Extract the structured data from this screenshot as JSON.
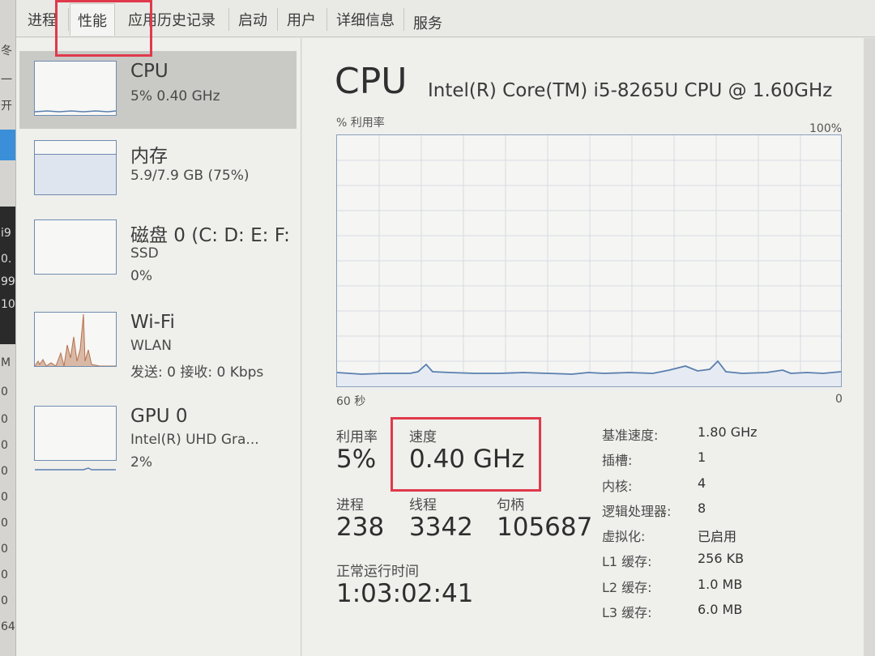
{
  "tabs": [
    {
      "label": "进程"
    },
    {
      "label": "性能"
    },
    {
      "label": "应用历史记录"
    },
    {
      "label": "启动"
    },
    {
      "label": "用户"
    },
    {
      "label": "详细信息"
    },
    {
      "label": "服务"
    }
  ],
  "sidebar": {
    "items": [
      {
        "title": "CPU",
        "line1": "5% 0.40 GHz",
        "line2": "",
        "line3": ""
      },
      {
        "title": "内存",
        "line1": "5.9/7.9 GB (75%)",
        "line2": "",
        "line3": ""
      },
      {
        "title": "磁盘 0 (C: D: E: F:",
        "line1": "SSD",
        "line2": "0%",
        "line3": ""
      },
      {
        "title": "Wi-Fi",
        "line1": "WLAN",
        "line2": "发送: 0 接收: 0 Kbps",
        "line3": ""
      },
      {
        "title": "GPU 0",
        "line1": "Intel(R) UHD Gra...",
        "line2": "2%",
        "line3": ""
      }
    ]
  },
  "main": {
    "title": "CPU",
    "model": "Intel(R) Core(TM) i5-8265U CPU @ 1.60GHz",
    "graph": {
      "y_label": "% 利用率",
      "y_max_label": "100%",
      "x_left_label": "60 秒",
      "x_right_label": "0"
    },
    "stats": {
      "utilization_label": "利用率",
      "utilization_value": "5%",
      "speed_label": "速度",
      "speed_value": "0.40 GHz",
      "processes_label": "进程",
      "processes_value": "238",
      "threads_label": "线程",
      "threads_value": "3342",
      "handles_label": "句柄",
      "handles_value": "105687",
      "uptime_label": "正常运行时间",
      "uptime_value": "1:03:02:41"
    },
    "details": [
      {
        "key": "基准速度:",
        "value": "1.80 GHz"
      },
      {
        "key": "插槽:",
        "value": "1"
      },
      {
        "key": "内核:",
        "value": "4"
      },
      {
        "key": "逻辑处理器:",
        "value": "8"
      },
      {
        "key": "虚拟化:",
        "value": "已启用"
      },
      {
        "key": "L1 缓存:",
        "value": "256 KB"
      },
      {
        "key": "L2 缓存:",
        "value": "1.0 MB"
      },
      {
        "key": "L3 缓存:",
        "value": "6.0 MB"
      }
    ]
  },
  "left_edge": {
    "chars": [
      "冬",
      "一",
      "开",
      "i9",
      "0.",
      "99",
      "10",
      "M",
      "0",
      "0",
      "0",
      "0",
      "0",
      "0",
      "0",
      "0",
      "0",
      "0",
      "64"
    ]
  },
  "colors": {
    "highlight": "#e0394b",
    "graph_line": "#5a7fae",
    "wifi_bars": "#b5714e"
  }
}
